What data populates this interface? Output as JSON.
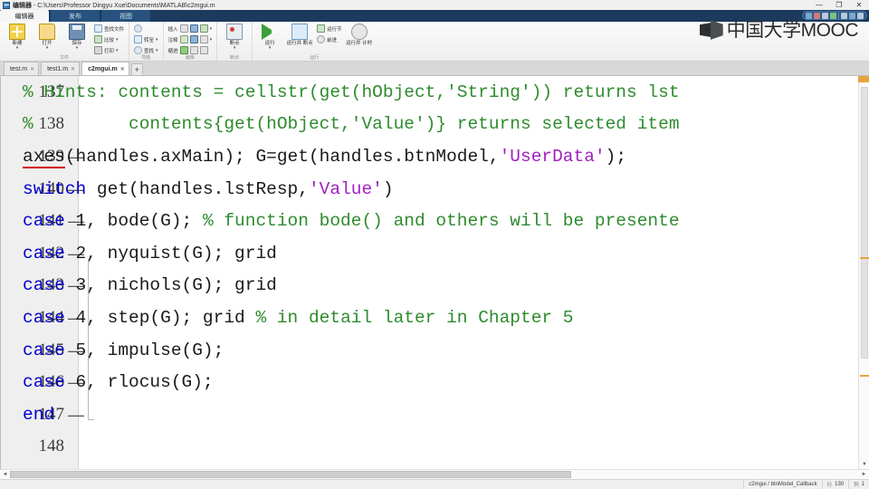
{
  "window": {
    "title_prefix": "编辑器",
    "title_sep": " - ",
    "title_path": "C:\\Users\\Professor Dingyu Xue\\Documents\\MATLAB\\c2mgui.m",
    "icon": "matlab-editor-icon",
    "minimize": "—",
    "maximize": "❐",
    "close": "✕"
  },
  "ribbon_tabs": [
    {
      "label": "编辑器",
      "active": true
    },
    {
      "label": "发布",
      "active": false
    },
    {
      "label": "视图",
      "active": false
    }
  ],
  "quick_access": {
    "items": [
      "save-icon",
      "cut-icon",
      "copy-icon",
      "paste-icon",
      "undo-icon",
      "redo-icon",
      "help-icon"
    ]
  },
  "ribbon_groups": [
    {
      "name": "文件",
      "label": "文件",
      "big_buttons": [
        {
          "label": "新建",
          "icon": "new-file-icon",
          "has_menu": true
        },
        {
          "label": "打开",
          "icon": "open-folder-icon",
          "has_menu": true
        },
        {
          "label": "保存",
          "icon": "save-disk-icon",
          "has_menu": true
        }
      ],
      "small_buttons": [
        {
          "label": "查找文件",
          "icon": "find-files-icon",
          "has_menu": false
        },
        {
          "label": "比较",
          "icon": "compare-icon",
          "has_menu": true
        },
        {
          "label": "打印",
          "icon": "print-icon",
          "has_menu": true
        }
      ]
    },
    {
      "name": "导航",
      "label": "导航",
      "small_buttons": [
        {
          "label": "",
          "icon": "goto-icon",
          "has_menu": false
        },
        {
          "label": "转至",
          "icon": "goto-line-icon",
          "has_menu": true
        },
        {
          "label": "查找",
          "icon": "search-icon",
          "has_menu": true
        }
      ]
    },
    {
      "name": "编辑",
      "label": "编辑",
      "small_buttons": [
        {
          "label": "插入",
          "icon": "insert-icon",
          "has_menu": false
        },
        {
          "label": "注释",
          "icon": "comment-icon",
          "has_menu": true
        },
        {
          "label": "缩进",
          "icon": "indent-icon",
          "has_menu": true
        }
      ],
      "extra_icons": [
        "fx-icon",
        "smart-indent-icon",
        "wrap-icon",
        "increase-indent-icon",
        "decrease-indent-icon"
      ]
    },
    {
      "name": "断点",
      "label": "断点",
      "big_buttons": [
        {
          "label": "断点",
          "icon": "breakpoint-icon",
          "has_menu": true
        }
      ]
    },
    {
      "name": "运行",
      "label": "运行",
      "big_buttons": [
        {
          "label": "运行",
          "icon": "run-icon",
          "has_menu": true
        },
        {
          "label": "运行并\n断点",
          "icon": "run-breakpoint-icon",
          "has_menu": false
        },
        {
          "label": "运行并\n计时",
          "icon": "run-time-icon",
          "has_menu": false
        }
      ],
      "small_buttons": [
        {
          "label": "运行节",
          "icon": "run-section-icon",
          "has_menu": false
        },
        {
          "label": "前进",
          "icon": "advance-icon",
          "has_menu": false
        }
      ]
    }
  ],
  "watermark": {
    "text": "中国大学MOOC",
    "icon": "mooc-cube-logo"
  },
  "doc_tabs": [
    {
      "label": "test.m",
      "active": false,
      "close": "✕"
    },
    {
      "label": "test1.m",
      "active": false,
      "close": "✕"
    },
    {
      "label": "c2mgui.m",
      "active": true,
      "close": "✕"
    }
  ],
  "doc_tab_add": "+",
  "editor": {
    "lines": [
      {
        "num": "137",
        "exec": "",
        "tokens": [
          {
            "t": "% Hints: contents = cellstr(get(hObject,'String')) returns lst",
            "c": "cm"
          }
        ]
      },
      {
        "num": "138",
        "exec": "",
        "tokens": [
          {
            "t": "%         contents{get(hObject,'Value')} returns selected item",
            "c": "cm"
          }
        ]
      },
      {
        "num": "139",
        "exec": "—",
        "tokens": [
          {
            "t": "axes",
            "c": "warn"
          },
          {
            "t": "(handles.axMain); G=get(handles.btnModel,",
            "c": ""
          },
          {
            "t": "'UserData'",
            "c": "str"
          },
          {
            "t": ");",
            "c": ""
          }
        ]
      },
      {
        "num": "140",
        "exec": "—",
        "tokens": [
          {
            "t": "switch",
            "c": "kw"
          },
          {
            "t": " get(handles.lstResp,",
            "c": ""
          },
          {
            "t": "'Value'",
            "c": "str"
          },
          {
            "t": ")",
            "c": ""
          }
        ]
      },
      {
        "num": "141",
        "exec": "—",
        "tokens": [
          {
            "t": "case",
            "c": "kw"
          },
          {
            "t": " 1, bode(G); ",
            "c": ""
          },
          {
            "t": "% function bode() and others will be presente",
            "c": "cm"
          }
        ]
      },
      {
        "num": "142",
        "exec": "—",
        "tokens": [
          {
            "t": "case",
            "c": "kw"
          },
          {
            "t": " 2, nyquist(G); grid",
            "c": ""
          }
        ]
      },
      {
        "num": "143",
        "exec": "—",
        "tokens": [
          {
            "t": "case",
            "c": "kw"
          },
          {
            "t": " 3, nichols(G); grid",
            "c": ""
          }
        ]
      },
      {
        "num": "144",
        "exec": "—",
        "tokens": [
          {
            "t": "case",
            "c": "kw"
          },
          {
            "t": " 4, step(G); grid ",
            "c": ""
          },
          {
            "t": "% in detail later in Chapter 5",
            "c": "cm"
          }
        ]
      },
      {
        "num": "145",
        "exec": "—",
        "tokens": [
          {
            "t": "case",
            "c": "kw"
          },
          {
            "t": " 5, impulse(G);",
            "c": ""
          }
        ]
      },
      {
        "num": "146",
        "exec": "—",
        "tokens": [
          {
            "t": "case",
            "c": "kw"
          },
          {
            "t": " 6, rlocus(G);",
            "c": ""
          }
        ]
      },
      {
        "num": "147",
        "exec": "—",
        "tokens": [
          {
            "t": "end",
            "c": "kw"
          }
        ]
      },
      {
        "num": "148",
        "exec": "",
        "tokens": []
      }
    ],
    "colors": {
      "keyword": "#0000cd",
      "comment": "#2e8b2e",
      "string": "#a020c0",
      "warning_underline": "#d40000",
      "text": "#1a1a1a"
    }
  },
  "scrollbars": {
    "v_up": "▲",
    "v_down": "▼",
    "h_left": "◄",
    "h_right": "►"
  },
  "statusbar": {
    "function_path": "c2mgui / btnModel_Callback",
    "line_label": "行",
    "line_value": "130",
    "col_label": "列",
    "col_value": "1"
  }
}
